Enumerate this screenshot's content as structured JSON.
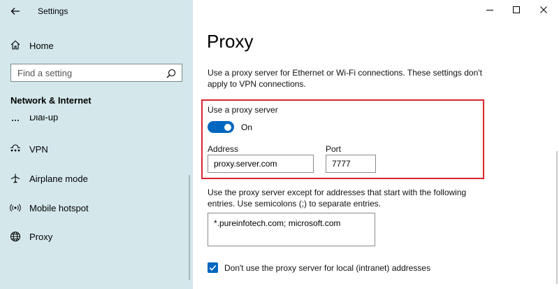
{
  "window": {
    "app_title": "Settings",
    "icons": {
      "back": "arrow-left-icon",
      "minimize": "minimize-icon",
      "maximize": "maximize-icon",
      "close": "close-icon"
    }
  },
  "sidebar": {
    "home_label": "Home",
    "search_placeholder": "Find a setting",
    "section_title": "Network & Internet",
    "items": [
      {
        "label": "Dial-up",
        "icon": "dialup-icon"
      },
      {
        "label": "VPN",
        "icon": "vpn-icon"
      },
      {
        "label": "Airplane mode",
        "icon": "airplane-icon"
      },
      {
        "label": "Mobile hotspot",
        "icon": "hotspot-icon"
      },
      {
        "label": "Proxy",
        "icon": "globe-icon",
        "selected": true
      }
    ]
  },
  "main": {
    "title": "Proxy",
    "description": "Use a proxy server for Ethernet or Wi-Fi connections. These settings don't apply to VPN connections.",
    "use_proxy": {
      "label": "Use a proxy server",
      "state_label": "On",
      "enabled": true
    },
    "address": {
      "label": "Address",
      "value": "proxy.server.com"
    },
    "port": {
      "label": "Port",
      "value": "7777"
    },
    "exceptions": {
      "description": "Use the proxy server except for addresses that start with the following entries. Use semicolons (;) to separate entries.",
      "value": "*.pureinfotech.com; microsoft.com"
    },
    "local_bypass": {
      "label": "Don't use the proxy server for local (intranet) addresses",
      "checked": true
    }
  },
  "colors": {
    "accent": "#0067c0",
    "sidebar_bg": "#d4e8ec",
    "highlight_border": "#d9252e"
  }
}
